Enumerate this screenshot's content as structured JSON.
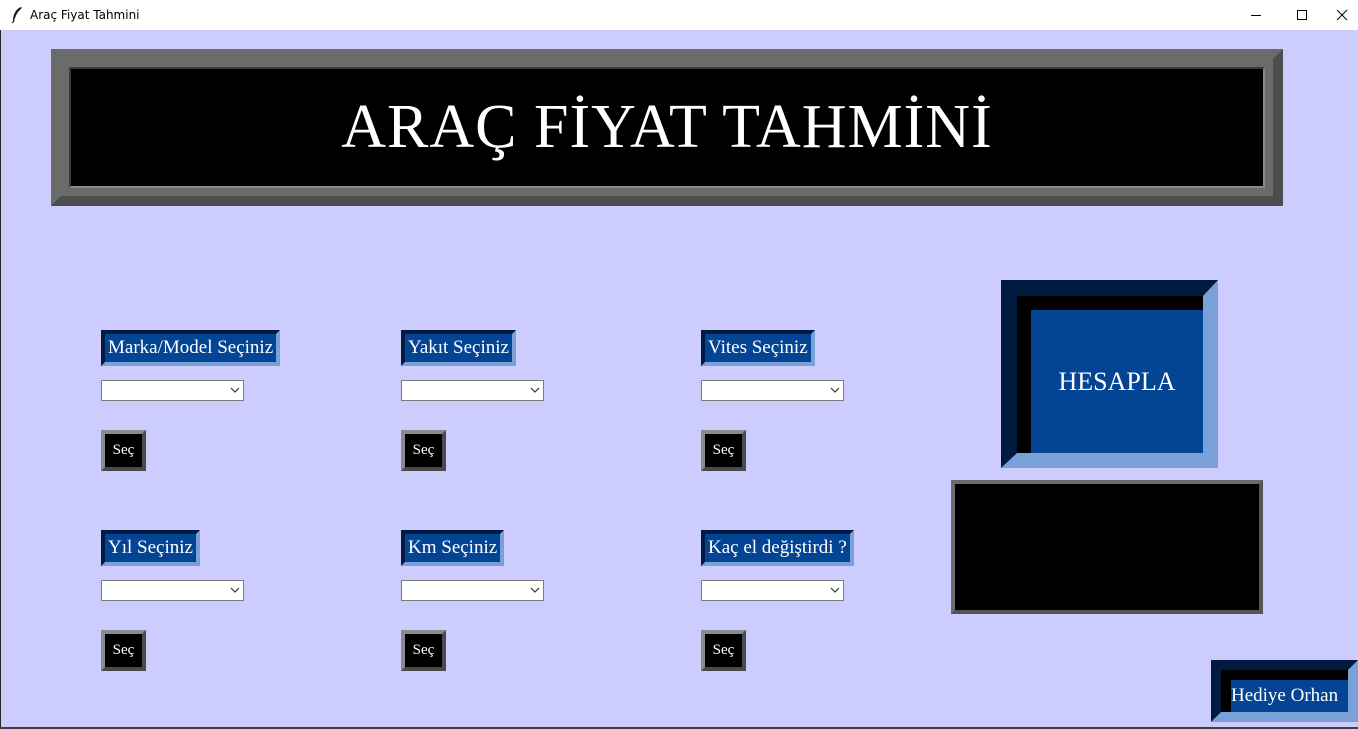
{
  "window": {
    "title": "Araç Fiyat Tahmini",
    "icon": "feather-icon",
    "controls": [
      "minimize-icon",
      "maximize-icon",
      "close-icon"
    ]
  },
  "colors": {
    "background": "#ccccff",
    "label_blue": "#034494",
    "header_black": "#000000",
    "frame_gray": "#6b6b6b"
  },
  "header": {
    "title": "ARAÇ FİYAT TAHMİNİ"
  },
  "fields": [
    {
      "label": "Marka/Model Seçiniz",
      "value": "",
      "button": "Seç"
    },
    {
      "label": "Yakıt Seçiniz",
      "value": "",
      "button": "Seç"
    },
    {
      "label": "Vites Seçiniz",
      "value": "",
      "button": "Seç"
    },
    {
      "label": "Yıl Seçiniz",
      "value": "",
      "button": "Seç"
    },
    {
      "label": "Km Seçiniz",
      "value": "",
      "button": "Seç"
    },
    {
      "label": "Kaç el değiştirdi ?",
      "value": "",
      "button": "Seç"
    }
  ],
  "actions": {
    "calculate": "HESAPLA",
    "result": ""
  },
  "credit": {
    "text": "Hediye Orhan"
  }
}
